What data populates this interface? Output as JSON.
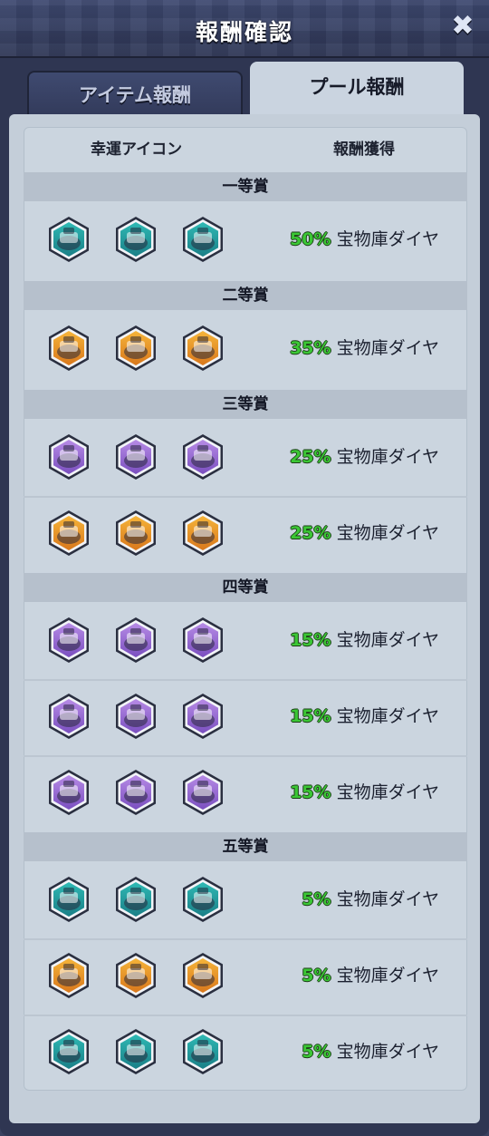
{
  "title": "報酬確認",
  "tabs": {
    "items": "アイテム報酬",
    "pool": "プール報酬"
  },
  "columns": {
    "icon": "幸運アイコン",
    "reward": "報酬獲得"
  },
  "reward_text": "宝物庫ダイヤ",
  "sections": [
    {
      "name": "一等賞",
      "rows": [
        {
          "pct": "50%",
          "color": "teal",
          "icon": "tank-icon"
        }
      ]
    },
    {
      "name": "二等賞",
      "rows": [
        {
          "pct": "35%",
          "color": "orange",
          "icon": "boat-icon"
        }
      ]
    },
    {
      "name": "三等賞",
      "rows": [
        {
          "pct": "25%",
          "color": "purple",
          "icon": "jet-icon"
        },
        {
          "pct": "25%",
          "color": "orange",
          "icon": "robot-icon"
        }
      ]
    },
    {
      "name": "四等賞",
      "rows": [
        {
          "pct": "15%",
          "color": "purple",
          "icon": "warship-icon"
        },
        {
          "pct": "15%",
          "color": "purple",
          "icon": "plane-icon"
        },
        {
          "pct": "15%",
          "color": "purple",
          "icon": "mech-icon"
        }
      ]
    },
    {
      "name": "五等賞",
      "rows": [
        {
          "pct": "5%",
          "color": "teal",
          "icon": "hovercraft-icon"
        },
        {
          "pct": "5%",
          "color": "orange",
          "icon": "fighter-icon"
        },
        {
          "pct": "5%",
          "color": "teal",
          "icon": "helicopter-icon"
        }
      ]
    }
  ],
  "palette": {
    "teal": [
      "#2fb9b4",
      "#1a7f87"
    ],
    "orange": [
      "#f5b43a",
      "#d9781c"
    ],
    "purple": [
      "#b78be6",
      "#7a4fc0"
    ]
  }
}
